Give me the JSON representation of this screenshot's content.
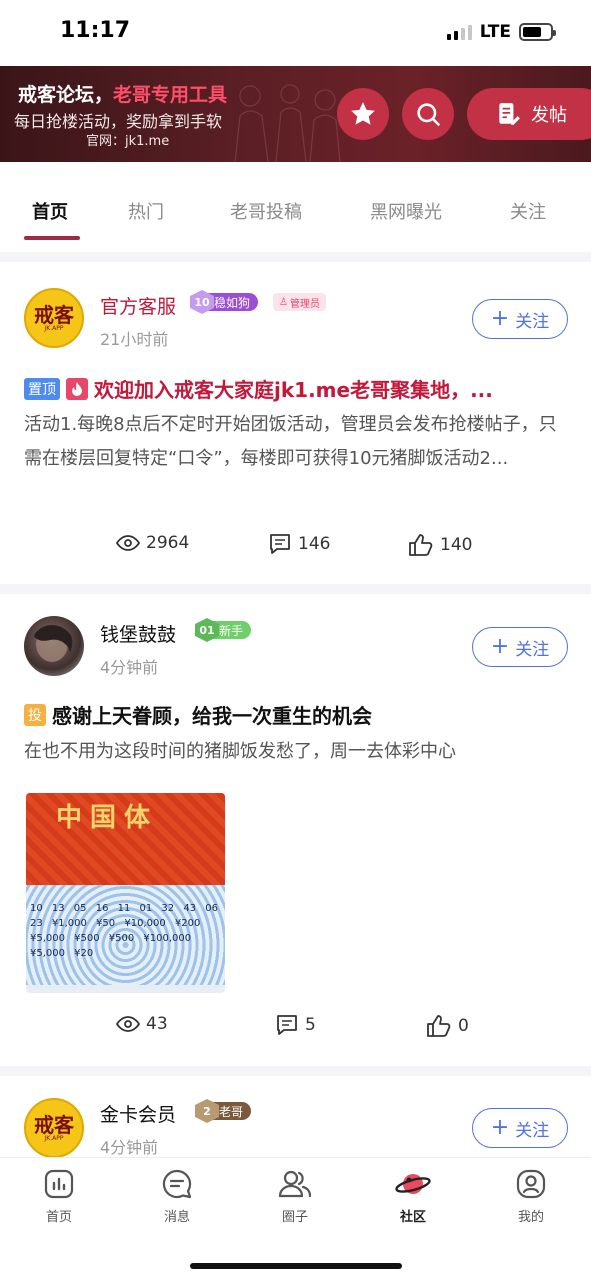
{
  "status_bar": {
    "time": "11:17",
    "network": "LTE"
  },
  "banner": {
    "title_prefix": "戒客论坛，",
    "title_highlight": "老哥专用工具",
    "subtitle": "每日抢楼活动，奖励拿到手软",
    "site": "官网：jk1.me",
    "star_icon": "star-icon",
    "search_icon": "search-icon",
    "post_button": "发帖"
  },
  "tabs": [
    "首页",
    "热门",
    "老哥投稿",
    "黑网曝光",
    "关注"
  ],
  "active_tab": "首页",
  "posts": [
    {
      "avatar": {
        "line1": "戒客",
        "line2": "JK.APP"
      },
      "username": "官方客服",
      "level": "10",
      "badge": "稳如狗",
      "admin_badge": "管理员",
      "time": "21小时前",
      "follow": "关注",
      "tag": "置顶",
      "title": "欢迎加入戒客大家庭jk1.me老哥聚集地，...",
      "excerpt": "活动1.每晚8点后不定时开始团饭活动，管理员会发布抢楼帖子，只需在楼层回复特定“口令”，每楼即可获得10元猪脚饭活动2...",
      "views": "2964",
      "comments": "146",
      "likes": "140"
    },
    {
      "username": "钱堡鼓鼓",
      "level": "01",
      "badge": "新手",
      "time": "4分钟前",
      "follow": "关注",
      "tag": "投",
      "title": "感谢上天眷顾，给我一次重生的机会",
      "excerpt": "在也不用为这段时间的猪脚饭发愁了，周一去体彩中心",
      "image_heading": "中国体",
      "image_numbers": "10 13 05 16 11 01 32 43 06 23 ¥1,000 ¥50 ¥10,000 ¥200 ¥5,000 ¥500 ¥500 ¥100,000 ¥5,000 ¥20",
      "views": "43",
      "comments": "5",
      "likes": "0"
    },
    {
      "avatar": {
        "line1": "戒客",
        "line2": "JK.APP"
      },
      "username": "金卡会员",
      "level": "2",
      "badge": "老哥",
      "time": "4分钟前",
      "follow": "关注"
    }
  ],
  "bottom_nav": [
    {
      "label": "首页",
      "icon": "chart-icon"
    },
    {
      "label": "消息",
      "icon": "message-icon"
    },
    {
      "label": "圈子",
      "icon": "users-icon"
    },
    {
      "label": "社区",
      "icon": "planet-icon"
    },
    {
      "label": "我的",
      "icon": "profile-icon"
    }
  ],
  "active_nav": "社区",
  "colors": {
    "accent": "#c23145",
    "brand_red": "#c2183a",
    "follow_blue": "#4f73e3",
    "tab_underline": "#a0284a"
  }
}
